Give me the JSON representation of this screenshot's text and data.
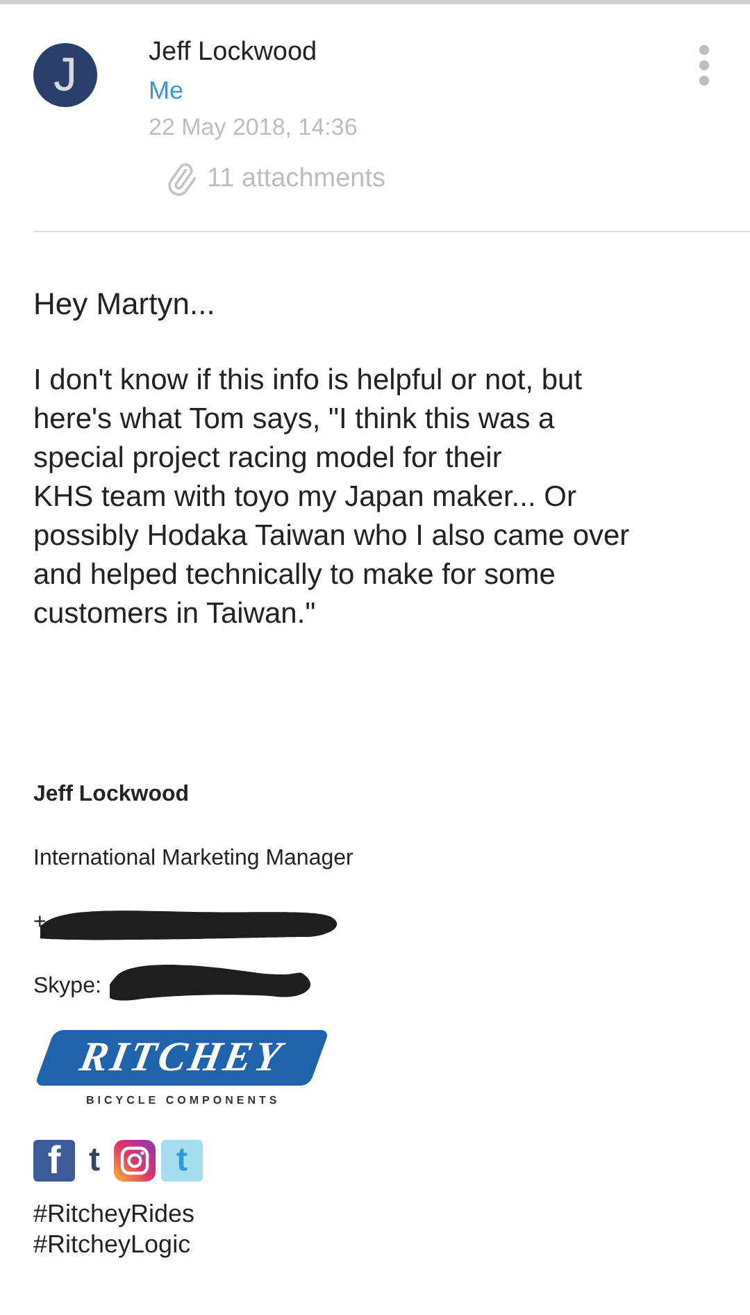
{
  "message": {
    "avatar_letter": "J",
    "sender": "Jeff Lockwood",
    "recipient": "Me",
    "date": "22 May 2018, 14:36",
    "attachments": "11 attachments"
  },
  "body": {
    "greeting": "Hey Martyn...",
    "paragraph": "I don't know if this info is helpful or not, but\nhere's what Tom says, \"I think this was a\nspecial project racing model for their\nKHS team with toyo my Japan maker... Or\npossibly Hodaka Taiwan who I also came over\nand helped technically to make for some\ncustomers in Taiwan.\""
  },
  "signature": {
    "name": "Jeff Lockwood",
    "title": "International Marketing Manager",
    "phone": "+",
    "skype": "Skype:",
    "logo": {
      "wordmark": "RITCHEY",
      "tagline": "BICYCLE COMPONENTS"
    },
    "social": [
      {
        "kind": "facebook",
        "glyph": "f"
      },
      {
        "kind": "tumblr",
        "glyph": "t"
      },
      {
        "kind": "instagram"
      },
      {
        "kind": "twitter",
        "glyph": "t"
      }
    ],
    "hashtags": [
      "#RitcheyRides",
      "#RitcheyLogic"
    ]
  }
}
